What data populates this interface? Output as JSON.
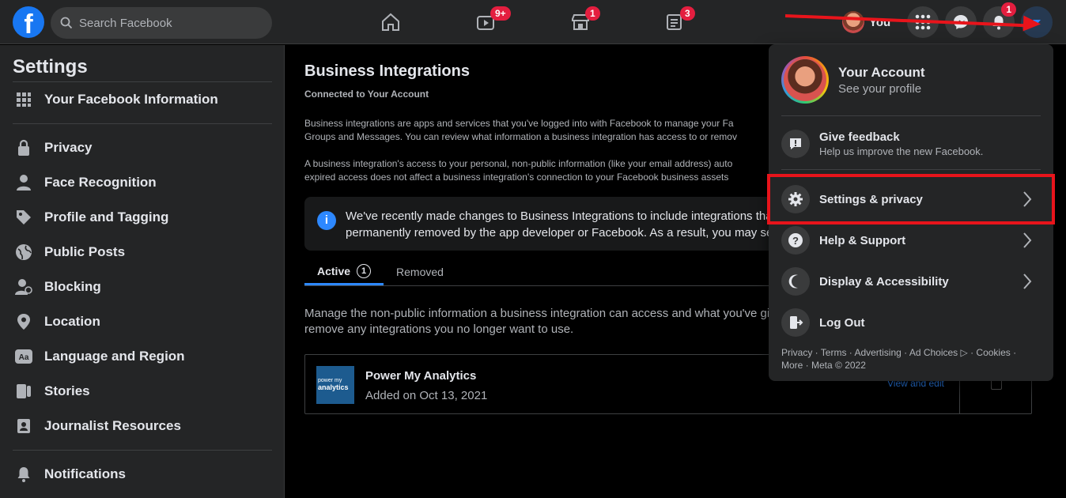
{
  "topbar": {
    "search_placeholder": "Search Facebook",
    "badges": {
      "watch": "9+",
      "marketplace": "1",
      "groups": "3",
      "notifications": "1"
    },
    "you_label": "You"
  },
  "sidebar": {
    "title": "Settings",
    "top_item": "Your Facebook Information",
    "items": [
      {
        "label": "Privacy",
        "icon": "lock-icon"
      },
      {
        "label": "Face Recognition",
        "icon": "person-icon"
      },
      {
        "label": "Profile and Tagging",
        "icon": "tag-icon"
      },
      {
        "label": "Public Posts",
        "icon": "globe-icon"
      },
      {
        "label": "Blocking",
        "icon": "block-person-icon"
      },
      {
        "label": "Location",
        "icon": "location-pin-icon"
      },
      {
        "label": "Language and Region",
        "icon": "language-icon"
      },
      {
        "label": "Stories",
        "icon": "stories-icon"
      },
      {
        "label": "Journalist Resources",
        "icon": "journalist-icon"
      }
    ],
    "bottom_item": "Notifications"
  },
  "main": {
    "title": "Business Integrations",
    "subtitle": "Connected to Your Account",
    "para1_line1": "Business integrations are apps and services that you've logged into with Facebook to manage your Fa",
    "para1_line2": "Groups and Messages. You can review what information a business integration has access to or remov",
    "para2_line1": "A business integration's access to your personal, non-public information (like your email address) auto",
    "para2_line2": "expired access does not affect a business integration's connection to your Facebook business assets",
    "info_line1": "We've recently made changes to Business Integrations to include integrations tha",
    "info_line2": "permanently removed by the app developer or Facebook. As a result, you may se",
    "tabs": {
      "active": "Active",
      "active_count": "1",
      "removed": "Removed"
    },
    "manage_line1": "Manage the non-public information a business integration can access and what you've gi",
    "manage_line2": "remove any integrations you no longer want to use.",
    "integration": {
      "logo_text_1": "power my",
      "logo_text_2": "analytics",
      "name": "Power My Analytics",
      "date": "Added on Oct 13, 2021",
      "view_edit": "View and edit"
    }
  },
  "dropdown": {
    "account_name": "Your Account",
    "account_sub": "See your profile",
    "feedback_label": "Give feedback",
    "feedback_desc": "Help us improve the new Facebook.",
    "settings_label": "Settings & privacy",
    "help_label": "Help & Support",
    "display_label": "Display & Accessibility",
    "logout_label": "Log Out",
    "footer_line1": "Privacy · Terms · Advertising · Ad Choices ▷ · Cookies ·",
    "footer_line2": "More · Meta © 2022"
  },
  "colors": {
    "accent": "#2d88ff",
    "annotation": "#e8141b",
    "badge": "#e41e3f"
  }
}
